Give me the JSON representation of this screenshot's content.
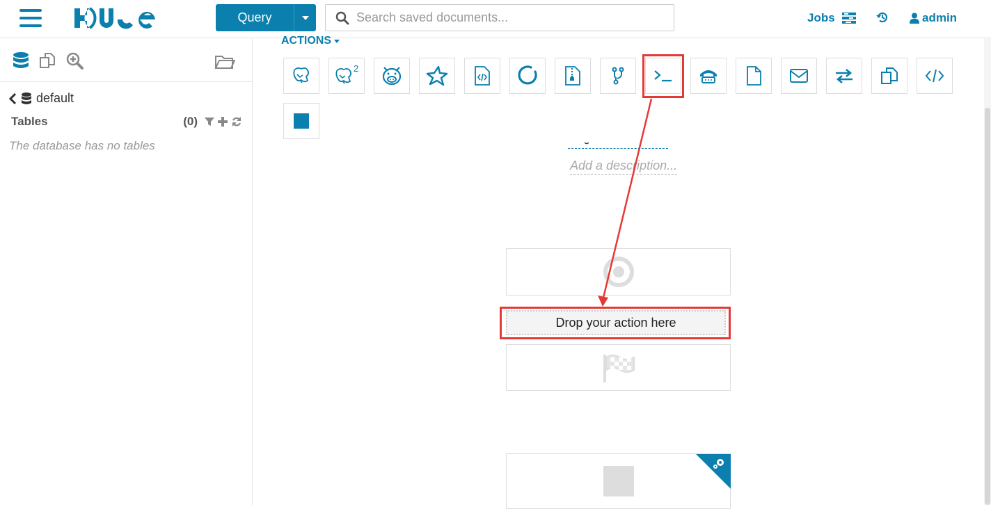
{
  "header": {
    "query_label": "Query",
    "search_placeholder": "Search saved documents...",
    "jobs_label": "Jobs",
    "user_label": "admin"
  },
  "left_panel": {
    "icons": [
      "database-icon",
      "copy-icon",
      "search-plus-icon",
      "folder-open-icon"
    ],
    "database_name": "default",
    "tables_label": "Tables",
    "tables_count": "(0)",
    "empty_message": "The database has no tables"
  },
  "main": {
    "actions_label": "ACTIONS",
    "tools": [
      {
        "name": "hive-icon"
      },
      {
        "name": "hive2-icon",
        "superscript": "2"
      },
      {
        "name": "pig-icon"
      },
      {
        "name": "spark-icon"
      },
      {
        "name": "java-icon"
      },
      {
        "name": "sqoop-icon"
      },
      {
        "name": "mapreduce-icon"
      },
      {
        "name": "subworkflow-icon"
      },
      {
        "name": "shell-icon"
      },
      {
        "name": "ssh-icon"
      },
      {
        "name": "hdfs-fs-icon"
      },
      {
        "name": "email-icon"
      },
      {
        "name": "streaming-icon"
      },
      {
        "name": "distcp-icon"
      },
      {
        "name": "generic-action-icon"
      },
      {
        "name": "kill-icon"
      }
    ],
    "description_placeholder": "Add a description...",
    "drop_zone_label": "Drop your action here"
  },
  "colors": {
    "accent": "#0b7fad",
    "annotation": "#e53935"
  }
}
